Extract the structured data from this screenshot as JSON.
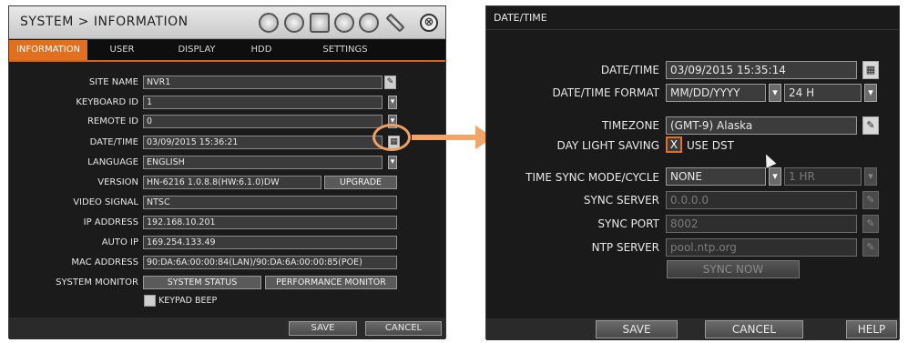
{
  "left": {
    "title": "SYSTEM > INFORMATION",
    "close_label": "⊗",
    "tabs": [
      {
        "label": "INFORMATION",
        "active": true
      },
      {
        "label": "USER",
        "active": false
      },
      {
        "label": "DISPLAY",
        "active": false
      },
      {
        "label": "HDD",
        "active": false
      },
      {
        "label": "SETTINGS",
        "active": false
      }
    ],
    "rows": {
      "site_name": {
        "label": "SITE NAME",
        "value": "NVR1"
      },
      "keyboard_id": {
        "label": "KEYBOARD ID",
        "value": "1"
      },
      "remote_id": {
        "label": "REMOTE ID",
        "value": "0"
      },
      "date_time": {
        "label": "DATE/TIME",
        "value": "03/09/2015 15:36:21"
      },
      "language": {
        "label": "LANGUAGE",
        "value": "ENGLISH"
      },
      "version": {
        "label": "VERSION",
        "value": "HN-6216 1.0.8.8(HW:6.1.0)DW",
        "button": "UPGRADE"
      },
      "video_signal": {
        "label": "VIDEO SIGNAL",
        "value": "NTSC"
      },
      "ip_address": {
        "label": "IP ADDRESS",
        "value": "192.168.10.201"
      },
      "auto_ip": {
        "label": "AUTO IP",
        "value": "169.254.133.49"
      },
      "mac_address": {
        "label": "MAC ADDRESS",
        "value": "90:DA:6A:00:00:84(LAN)/90:DA:6A:00:00:85(POE)"
      },
      "system_monitor": {
        "label": "SYSTEM MONITOR",
        "status_button": "SYSTEM STATUS",
        "performance_button": "PERFORMANCE MONITOR"
      }
    },
    "keypad_beep": "KEYPAD BEEP",
    "save_label": "SAVE",
    "cancel_label": "CANCEL"
  },
  "right": {
    "title": "DATE/TIME",
    "date_time": {
      "label": "DATE/TIME",
      "value": "03/09/2015 15:35:14"
    },
    "format": {
      "label": "DATE/TIME FORMAT",
      "date_value": "MM/DD/YYYY",
      "hour_value": "24 H"
    },
    "timezone": {
      "label": "TIMEZONE",
      "value": "(GMT-9) Alaska"
    },
    "dst": {
      "label": "DAY LIGHT SAVING",
      "check_mark": "X",
      "check_label": "USE DST"
    },
    "sync_mode": {
      "label": "TIME SYNC MODE/CYCLE",
      "mode_value": "NONE",
      "cycle_value": "1 HR"
    },
    "sync_server": {
      "label": "SYNC SERVER",
      "value": "0.0.0.0"
    },
    "sync_port": {
      "label": "SYNC PORT",
      "value": "8002"
    },
    "ntp_server": {
      "label": "NTP SERVER",
      "value": "pool.ntp.org"
    },
    "sync_now": "SYNC NOW",
    "save_label": "SAVE",
    "cancel_label": "CANCEL",
    "help_label": "HELP"
  },
  "colors": {
    "accent_orange": "#e0701f",
    "highlight": "#f2a56a"
  }
}
